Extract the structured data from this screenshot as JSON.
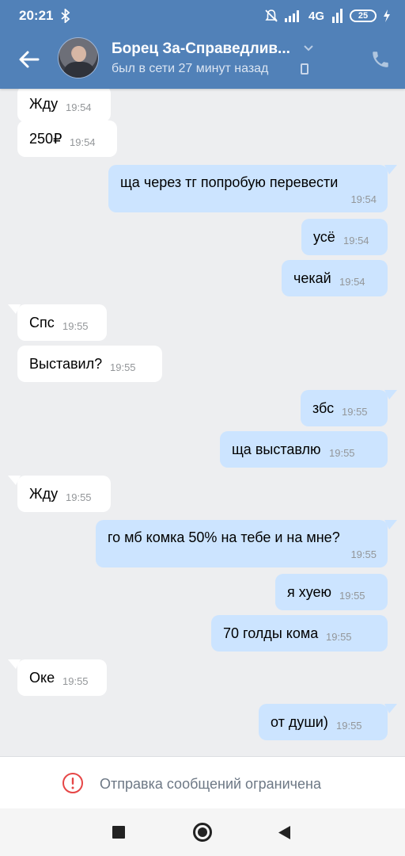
{
  "status_bar": {
    "time": "20:21",
    "network": "4G",
    "battery": "25"
  },
  "header": {
    "contact_name": "Борец За-Справедлив...",
    "last_seen": "был в сети 27 минут назад"
  },
  "messages": [
    {
      "dir": "in",
      "text": "Жду",
      "time": "19:54"
    },
    {
      "dir": "in",
      "text": "250₽",
      "time": "19:54"
    },
    {
      "dir": "out",
      "text": "ща через тг попробую перевести",
      "time": "19:54"
    },
    {
      "dir": "out",
      "text": "усё",
      "time": "19:54"
    },
    {
      "dir": "out",
      "text": "чекай",
      "time": "19:54"
    },
    {
      "dir": "in",
      "text": "Спс",
      "time": "19:55"
    },
    {
      "dir": "in",
      "text": "Выставил?",
      "time": "19:55"
    },
    {
      "dir": "out",
      "text": "збс",
      "time": "19:55"
    },
    {
      "dir": "out",
      "text": "ща выставлю",
      "time": "19:55"
    },
    {
      "dir": "in",
      "text": "Жду",
      "time": "19:55"
    },
    {
      "dir": "out",
      "text": "го мб комка 50% на тебе и на мне?",
      "time": "19:55"
    },
    {
      "dir": "out",
      "text": "я хуею",
      "time": "19:55"
    },
    {
      "dir": "out",
      "text": "70 голды кома",
      "time": "19:55"
    },
    {
      "dir": "in",
      "text": "Оке",
      "time": "19:55"
    },
    {
      "dir": "out",
      "text": "от души)",
      "time": "19:55"
    }
  ],
  "restricted": {
    "text": "Отправка сообщений ограничена",
    "icon": "warning-icon",
    "color": "#e64646"
  },
  "colors": {
    "header": "#5181b8",
    "incoming_bubble": "#ffffff",
    "outgoing_bubble": "#cce4ff",
    "background": "#edeef0"
  }
}
